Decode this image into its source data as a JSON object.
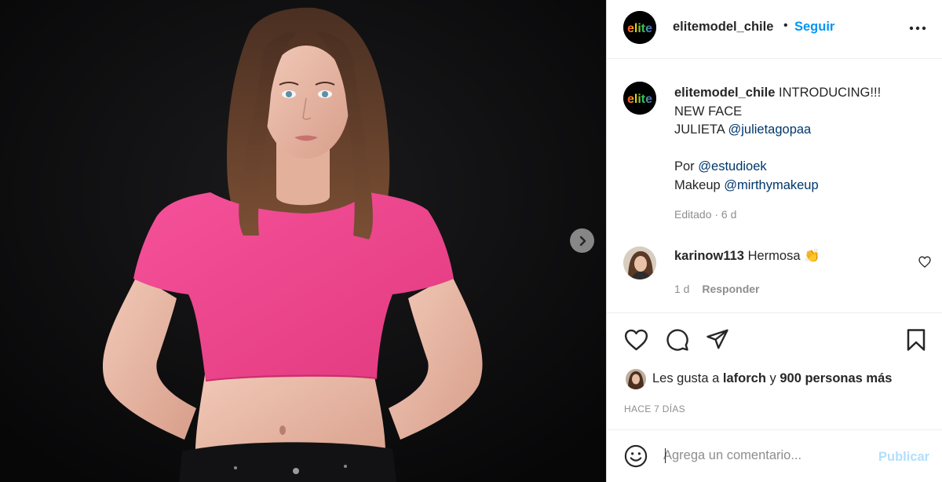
{
  "header": {
    "username": "elitemodel_chile",
    "separator": "•",
    "follow_label": "Seguir",
    "logo_text": "elite"
  },
  "caption": {
    "username": "elitemodel_chile",
    "line1_text": "INTRODUCING!!!",
    "line2": "NEW FACE",
    "line3_text": "JULIETA",
    "line3_mention": "@julietagopaa",
    "line4_text": "Por",
    "line4_mention": "@estudioek",
    "line5_text": "Makeup",
    "line5_mention": "@mirthymakeup",
    "meta": "Editado · 6 d"
  },
  "comment": {
    "username": "karinow113",
    "text": "Hermosa",
    "emoji": "👏",
    "age": "1 d",
    "reply_label": "Responder"
  },
  "likes": {
    "prefix": "Les gusta a",
    "user": "laforch",
    "middle": "y",
    "count": "900 personas más"
  },
  "timestamp": "HACE 7 DÍAS",
  "add_comment": {
    "placeholder": "Agrega un comentario...",
    "publish_label": "Publicar"
  },
  "colors": {
    "link_blue": "#0095f6",
    "mention_blue": "#00376b",
    "publish_disabled": "#b2dffc",
    "shirt_pink": "#f0418c"
  },
  "icons": {
    "next": "chevron-right-icon",
    "more": "more-options-icon",
    "like": "heart-icon",
    "comment": "comment-bubble-icon",
    "share": "paper-plane-icon",
    "save": "bookmark-icon",
    "emoji": "smiley-icon"
  }
}
